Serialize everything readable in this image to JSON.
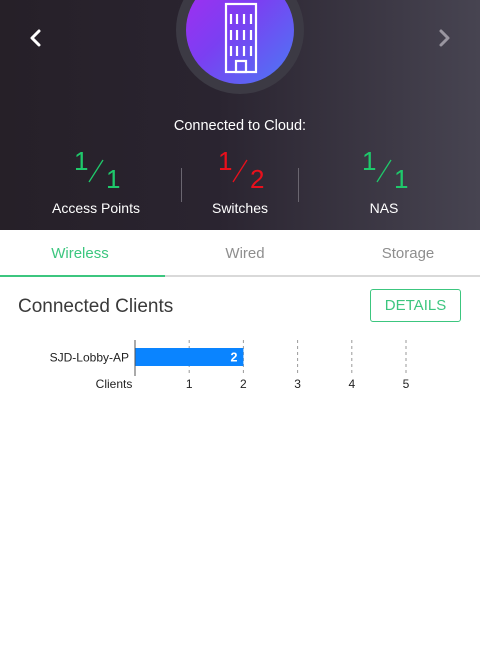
{
  "header": {
    "prev_icon": "chevron-left-icon",
    "next_icon": "chevron-right-icon",
    "hero_icon": "building-icon",
    "cloud_label": "Connected to Cloud:",
    "stats": [
      {
        "connected": "1",
        "total": "1",
        "label": "Access Points",
        "status_color": "#1fc96b"
      },
      {
        "connected": "1",
        "total": "2",
        "label": "Switches",
        "status_color": "#e8101c"
      },
      {
        "connected": "1",
        "total": "1",
        "label": "NAS",
        "status_color": "#1fc96b"
      }
    ]
  },
  "tabs": [
    {
      "label": "Wireless",
      "active": true
    },
    {
      "label": "Wired",
      "active": false
    },
    {
      "label": "Storage",
      "active": false
    }
  ],
  "section": {
    "title": "Connected Clients",
    "details_label": "DETAILS"
  },
  "colors": {
    "accent": "#3cc67f",
    "bar": "#0a84ff"
  },
  "chart_data": {
    "type": "bar",
    "orientation": "horizontal",
    "categories": [
      "SJD-Lobby-AP"
    ],
    "values": [
      2
    ],
    "data_labels": [
      "2"
    ],
    "xlabel": "Clients",
    "xlim": [
      0,
      5
    ],
    "xticks": [
      "1",
      "2",
      "3",
      "4",
      "5"
    ],
    "grid": "vertical-dashed"
  }
}
